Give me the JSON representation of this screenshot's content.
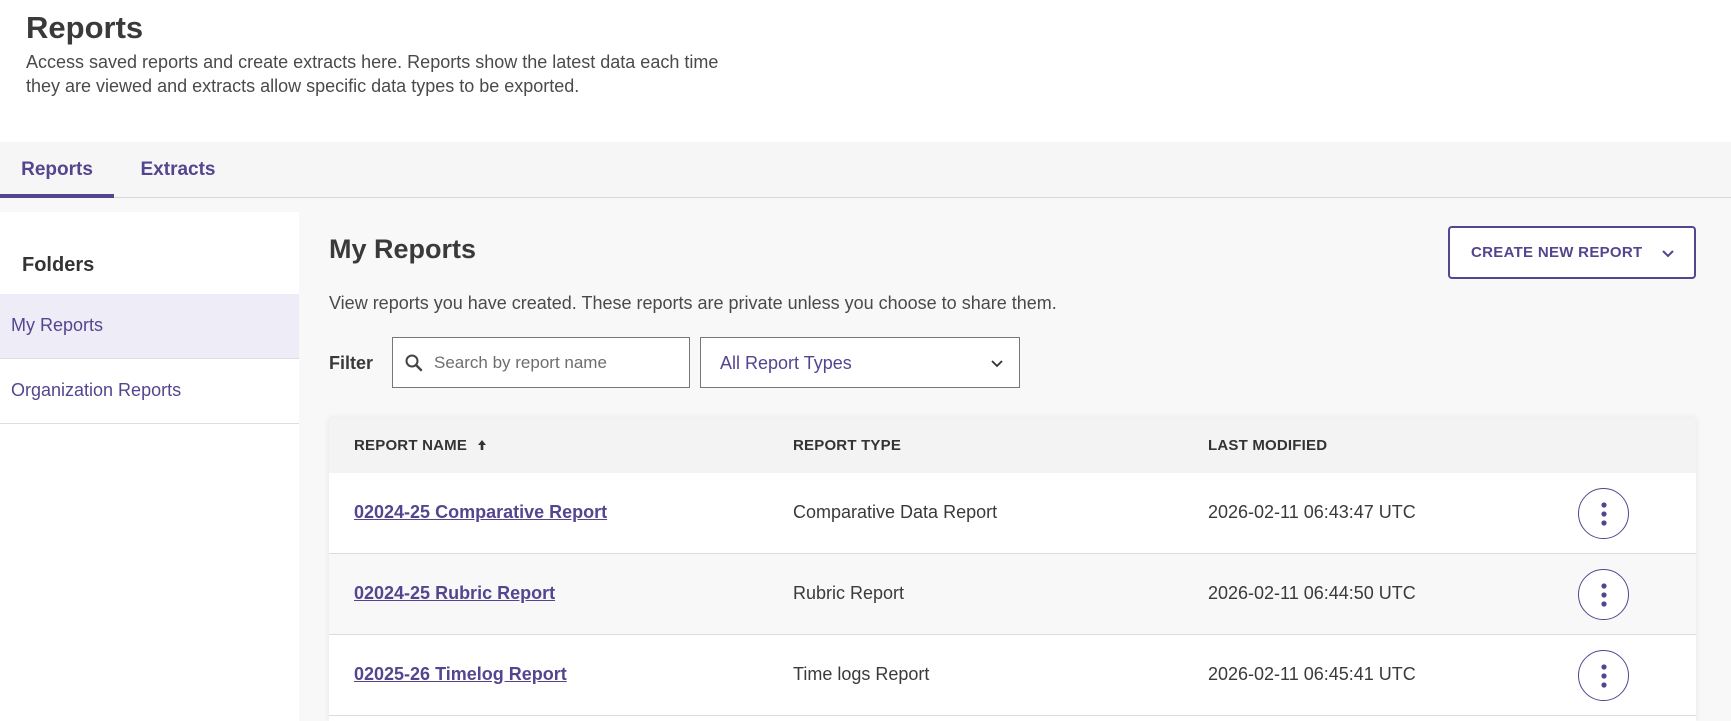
{
  "header": {
    "title": "Reports",
    "description": "Access saved reports and create extracts here. Reports show the latest data each time they are viewed and extracts allow specific data types to be exported."
  },
  "tabs": [
    {
      "label": "Reports",
      "active": true
    },
    {
      "label": "Extracts",
      "active": false
    }
  ],
  "sidebar": {
    "heading": "Folders",
    "items": [
      {
        "label": "My Reports",
        "active": true
      },
      {
        "label": "Organization Reports",
        "active": false
      }
    ]
  },
  "main": {
    "title": "My Reports",
    "description": "View reports you have created. These reports are private unless you choose to share them.",
    "create_button_label": "CREATE NEW REPORT",
    "filter": {
      "label": "Filter",
      "search_placeholder": "Search by report name",
      "search_value": "",
      "type_selected": "All Report Types"
    }
  },
  "table": {
    "columns": [
      "REPORT NAME",
      "REPORT TYPE",
      "LAST MODIFIED"
    ],
    "sort": {
      "column": "REPORT NAME",
      "direction": "ascending"
    },
    "rows": [
      {
        "name": "02024-25 Comparative Report",
        "type": "Comparative Data Report",
        "modified": "2026-02-11 06:43:47 UTC"
      },
      {
        "name": "02024-25 Rubric Report",
        "type": "Rubric Report",
        "modified": "2026-02-11 06:44:50 UTC"
      },
      {
        "name": "02025-26 Timelog Report",
        "type": "Time logs Report",
        "modified": "2026-02-11 06:45:41 UTC"
      }
    ]
  },
  "colors": {
    "accent": "#55458f",
    "active_sidebar_bg": "#eeecf7",
    "page_bg": "#f8f8f8"
  },
  "icons": {
    "search": "search-icon",
    "dropdown": "chevron-down-icon",
    "sort": "arrow-up-icon",
    "row_menu": "more-vertical-icon"
  }
}
